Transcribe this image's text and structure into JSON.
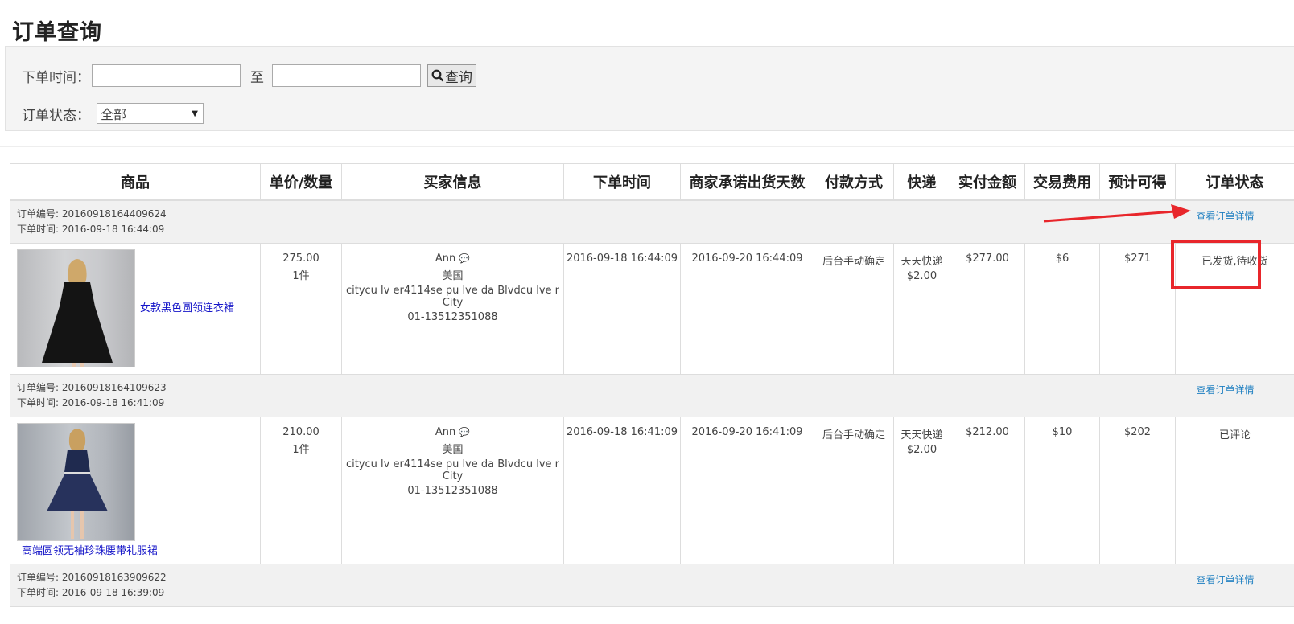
{
  "page": {
    "title": "订单查询"
  },
  "filters": {
    "date_label": "下单时间：",
    "date_sep": "至",
    "date_from": "",
    "date_to": "",
    "search_label": "查询",
    "status_label": "订单状态：",
    "status_selected": "全部"
  },
  "table": {
    "columns": [
      "商品",
      "单价/数量",
      "买家信息",
      "下单时间",
      "商家承诺出货天数",
      "付款方式",
      "快递",
      "实付金额",
      "交易费用",
      "预计可得",
      "订单状态"
    ],
    "detail_link_label": "查看订单详情",
    "orders": [
      {
        "order_no": "订单编号: 20160918164409624",
        "order_time": "下单时间: 2016-09-18 16:44:09",
        "product_name": "女款黑色圆领连衣裙",
        "price": "275.00",
        "qty": "1件",
        "buyer_name": "Ann",
        "buyer_country": "美国",
        "buyer_address": "citycu lv er4114se pu lve da Blvdcu lve r City",
        "buyer_phone": "01-13512351088",
        "placed_at": "2016-09-18 16:44:09",
        "ship_deadline": "2016-09-20 16:44:09",
        "payment": "后台手动确定",
        "courier": "天天快递",
        "courier_fee": "$2.00",
        "paid": "$277.00",
        "fee": "$6",
        "net": "$271",
        "status": "已发货,待收货"
      },
      {
        "order_no": "订单编号: 20160918164109623",
        "order_time": "下单时间: 2016-09-18 16:41:09",
        "product_name": "高端圆领无袖珍珠腰带礼服裙",
        "price": "210.00",
        "qty": "1件",
        "buyer_name": "Ann",
        "buyer_country": "美国",
        "buyer_address": "citycu lv er4114se pu lve da Blvdcu lve r City",
        "buyer_phone": "01-13512351088",
        "placed_at": "2016-09-18 16:41:09",
        "ship_deadline": "2016-09-20 16:41:09",
        "payment": "后台手动确定",
        "courier": "天天快递",
        "courier_fee": "$2.00",
        "paid": "$212.00",
        "fee": "$10",
        "net": "$202",
        "status": "已评论"
      },
      {
        "order_no": "订单编号: 20160918163909622",
        "order_time": "下单时间: 2016-09-18 16:39:09"
      }
    ]
  },
  "annotation": {
    "color": "#e8262b"
  }
}
